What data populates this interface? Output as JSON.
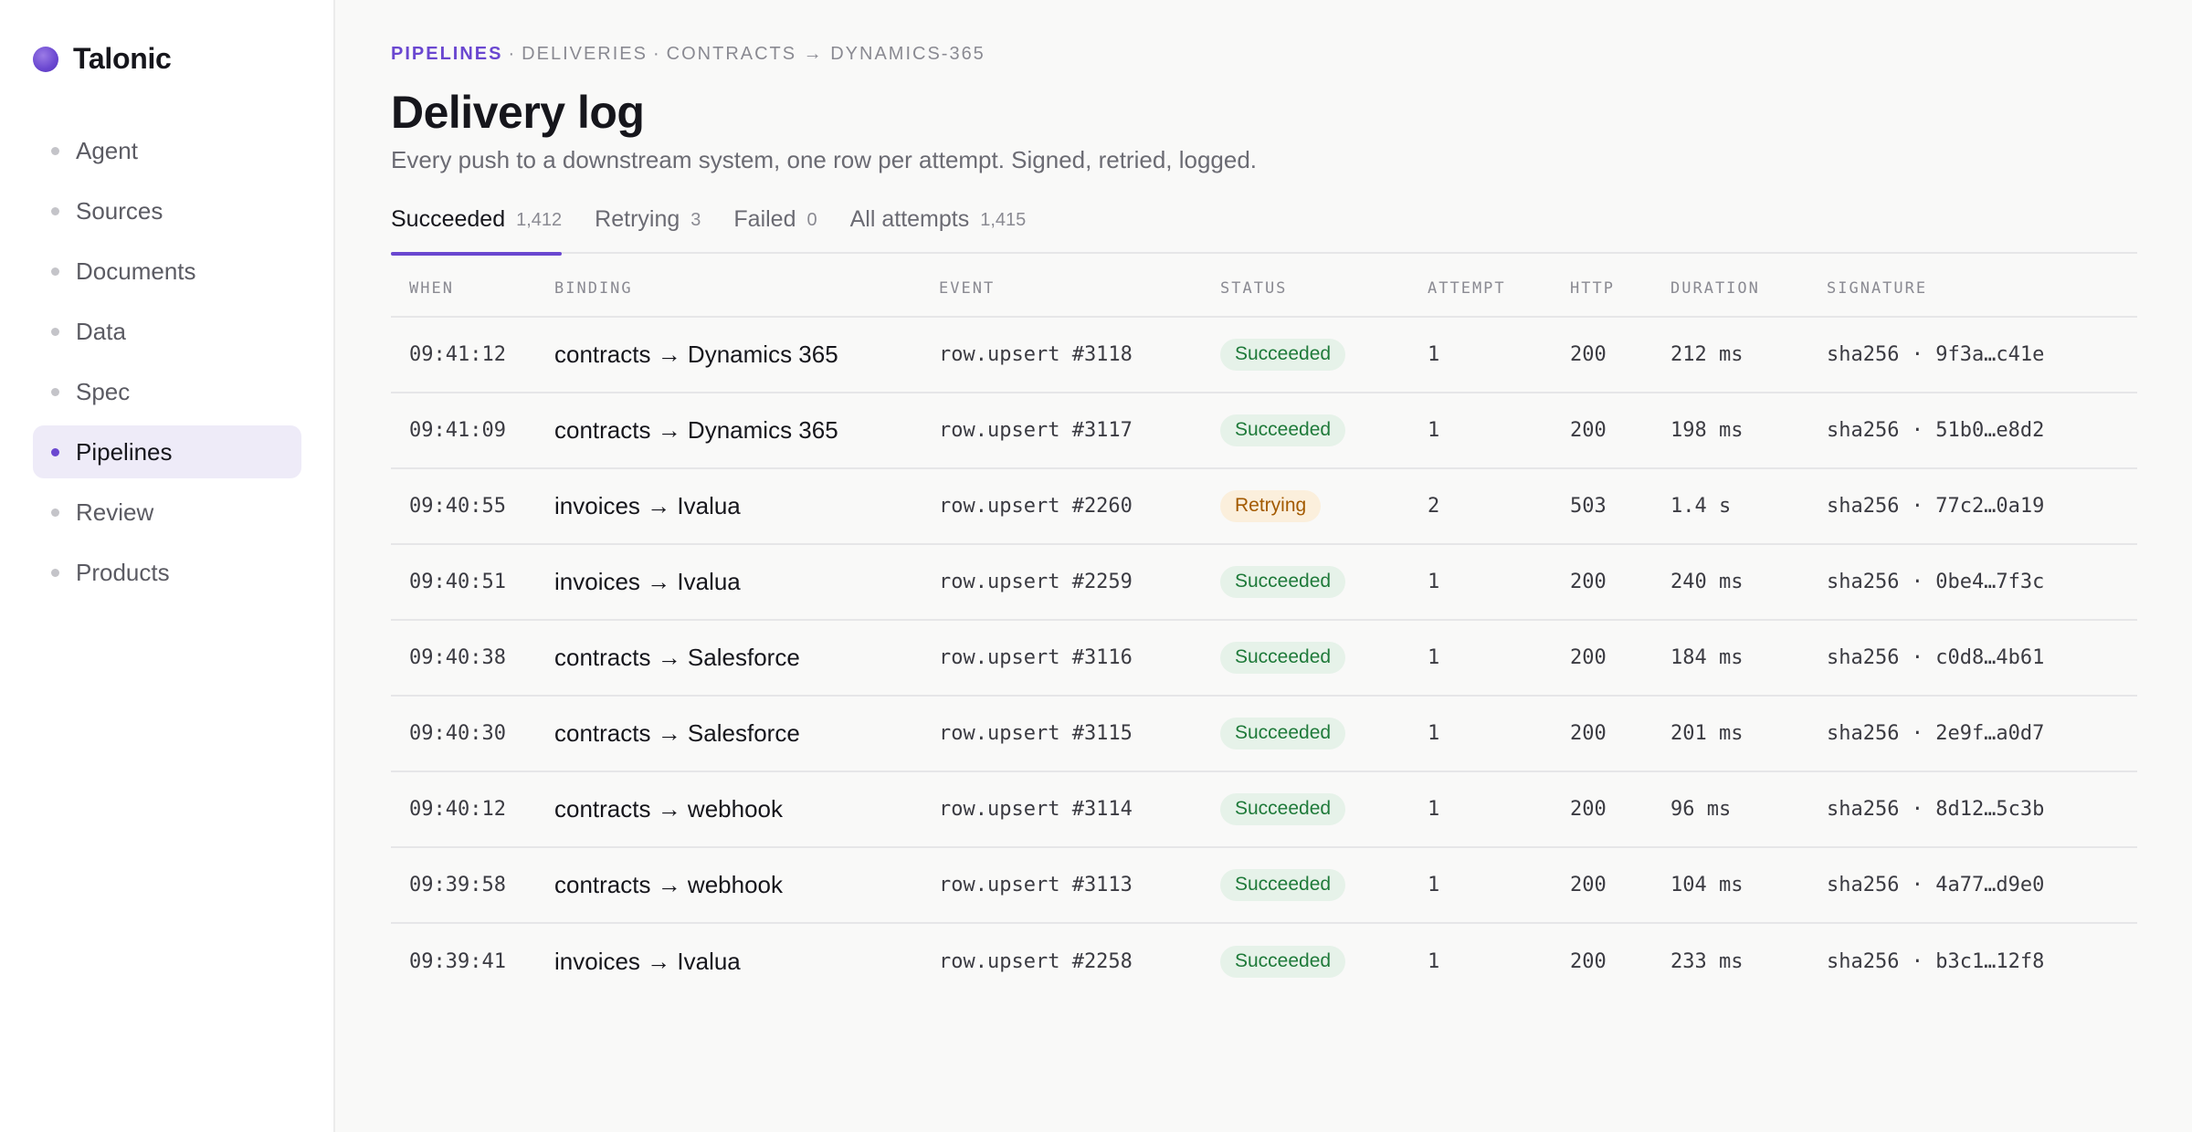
{
  "app": {
    "name": "Talonic"
  },
  "sidebar": {
    "items": [
      {
        "label": "Agent",
        "active": false
      },
      {
        "label": "Sources",
        "active": false
      },
      {
        "label": "Documents",
        "active": false
      },
      {
        "label": "Data",
        "active": false
      },
      {
        "label": "Spec",
        "active": false
      },
      {
        "label": "Pipelines",
        "active": true
      },
      {
        "label": "Review",
        "active": false
      },
      {
        "label": "Products",
        "active": false
      }
    ]
  },
  "breadcrumb": {
    "items": [
      "PIPELINES",
      "DELIVERIES",
      "CONTRACTS → DYNAMICS-365"
    ],
    "separator": "·"
  },
  "page": {
    "title": "Delivery log",
    "subtitle": "Every push to a downstream system, one row per attempt. Signed, retried, logged."
  },
  "tabs": [
    {
      "label": "Succeeded",
      "count": "1,412",
      "active": true
    },
    {
      "label": "Retrying",
      "count": "3",
      "active": false
    },
    {
      "label": "Failed",
      "count": "0",
      "active": false
    },
    {
      "label": "All attempts",
      "count": "1,415",
      "active": false
    }
  ],
  "table": {
    "columns": [
      "WHEN",
      "BINDING",
      "EVENT",
      "STATUS",
      "ATTEMPT",
      "HTTP",
      "DURATION",
      "SIGNATURE"
    ],
    "rows": [
      {
        "when": "09:41:12",
        "binding": "contracts → Dynamics 365",
        "event": "row.upsert #3118",
        "status": "Succeeded",
        "attempt": "1",
        "http": "200",
        "duration": "212 ms",
        "signature": "sha256 · 9f3a…c41e"
      },
      {
        "when": "09:41:09",
        "binding": "contracts → Dynamics 365",
        "event": "row.upsert #3117",
        "status": "Succeeded",
        "attempt": "1",
        "http": "200",
        "duration": "198 ms",
        "signature": "sha256 · 51b0…e8d2"
      },
      {
        "when": "09:40:55",
        "binding": "invoices → Ivalua",
        "event": "row.upsert #2260",
        "status": "Retrying",
        "attempt": "2",
        "http": "503",
        "duration": "1.4 s",
        "signature": "sha256 · 77c2…0a19"
      },
      {
        "when": "09:40:51",
        "binding": "invoices → Ivalua",
        "event": "row.upsert #2259",
        "status": "Succeeded",
        "attempt": "1",
        "http": "200",
        "duration": "240 ms",
        "signature": "sha256 · 0be4…7f3c"
      },
      {
        "when": "09:40:38",
        "binding": "contracts → Salesforce",
        "event": "row.upsert #3116",
        "status": "Succeeded",
        "attempt": "1",
        "http": "200",
        "duration": "184 ms",
        "signature": "sha256 · c0d8…4b61"
      },
      {
        "when": "09:40:30",
        "binding": "contracts → Salesforce",
        "event": "row.upsert #3115",
        "status": "Succeeded",
        "attempt": "1",
        "http": "200",
        "duration": "201 ms",
        "signature": "sha256 · 2e9f…a0d7"
      },
      {
        "when": "09:40:12",
        "binding": "contracts → webhook",
        "event": "row.upsert #3114",
        "status": "Succeeded",
        "attempt": "1",
        "http": "200",
        "duration": "96 ms",
        "signature": "sha256 · 8d12…5c3b"
      },
      {
        "when": "09:39:58",
        "binding": "contracts → webhook",
        "event": "row.upsert #3113",
        "status": "Succeeded",
        "attempt": "1",
        "http": "200",
        "duration": "104 ms",
        "signature": "sha256 · 4a77…d9e0"
      },
      {
        "when": "09:39:41",
        "binding": "invoices → Ivalua",
        "event": "row.upsert #2258",
        "status": "Succeeded",
        "attempt": "1",
        "http": "200",
        "duration": "233 ms",
        "signature": "sha256 · b3c1…12f8"
      }
    ]
  },
  "colors": {
    "accent": "#6a47d0",
    "success_bg": "#e6f2e9",
    "success_text": "#1f7a3a",
    "retry_bg": "#fbefdc",
    "retry_text": "#a35a00"
  }
}
